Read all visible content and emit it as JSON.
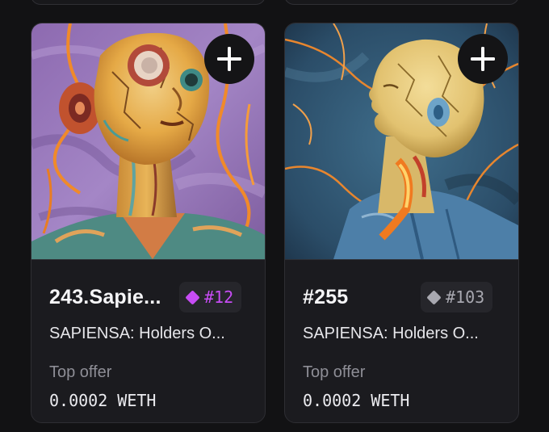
{
  "colors": {
    "background": "#121214",
    "card": "#1b1b1f",
    "rare_rank": "#c74cf5",
    "common_rank": "#a8a8b0",
    "muted_text": "#8e8e96"
  },
  "cards": [
    {
      "title": "243.Sapie...",
      "rank": "#12",
      "rank_icon": "diamond-icon",
      "collection": "SAPIENSA: Holders O...",
      "offer_label": "Top offer",
      "offer_value": "0.0002 WETH",
      "add_icon": "plus-icon"
    },
    {
      "title": "#255",
      "rank": "#103",
      "rank_icon": "diamond-icon",
      "collection": "SAPIENSA: Holders O...",
      "offer_label": "Top offer",
      "offer_value": "0.0002 WETH",
      "add_icon": "plus-icon"
    }
  ]
}
